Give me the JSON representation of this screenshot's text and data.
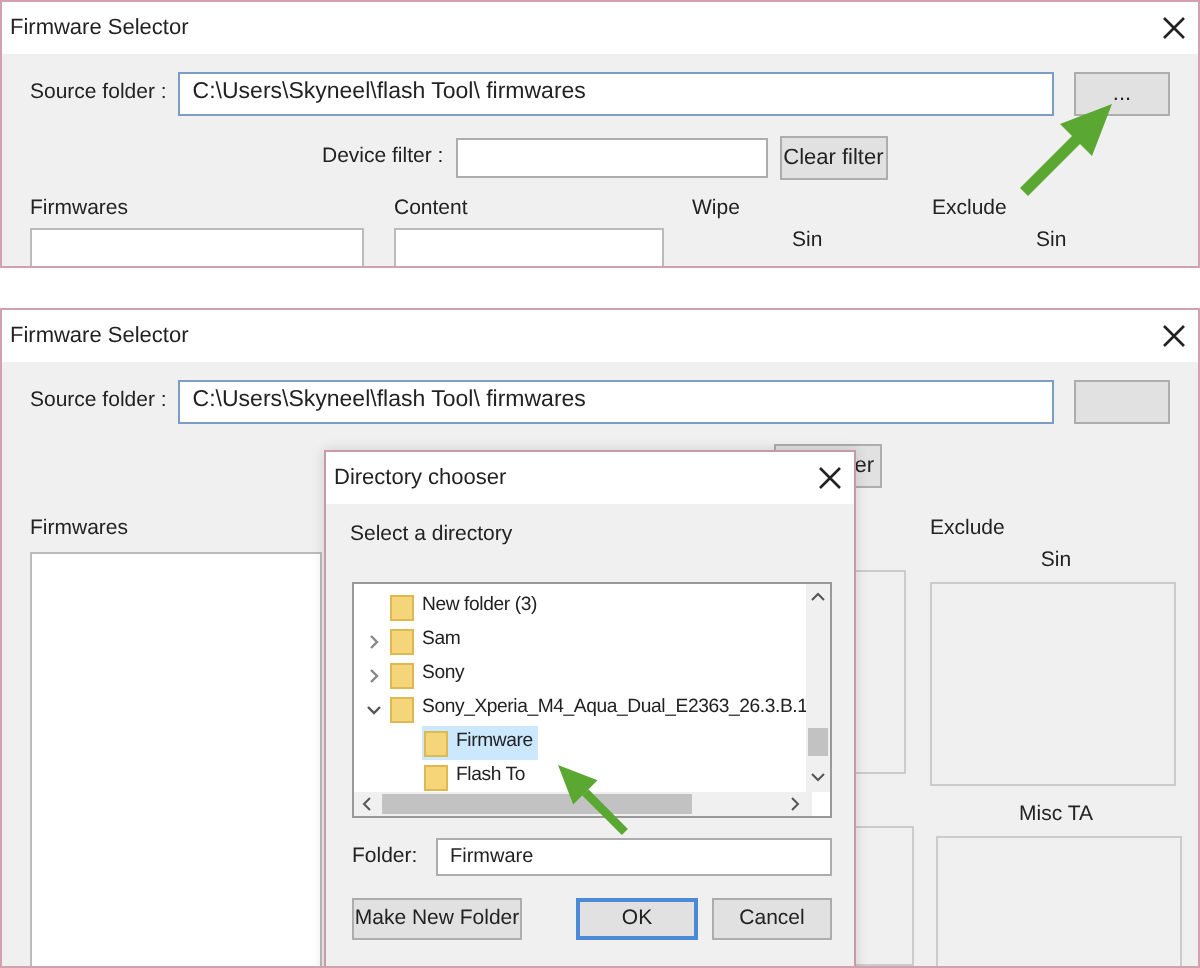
{
  "first_window": {
    "title": "Firmware Selector",
    "source_folder_label": "Source folder :",
    "source_folder_value": "C:\\Users\\Skyneel\\flash Tool\\ firmwares",
    "browse_button": "...",
    "device_filter_label": "Device filter :",
    "clear_filter_button": "Clear filter",
    "section_labels": [
      "Firmwares",
      "Content",
      "Wipe",
      "Exclude"
    ],
    "sin_labels": [
      "Sin",
      "Sin"
    ]
  },
  "second_window": {
    "title": "Firmware Selector",
    "source_folder_label": "Source folder :",
    "source_folder_value": "C:\\Users\\Skyneel\\flash Tool\\ firmwares",
    "clear_filter_button": "er",
    "firmwares_label": "Firmwares",
    "exclude_label": "Exclude",
    "sin_label": "Sin",
    "misc_ta_label": "Misc TA"
  },
  "directory_chooser": {
    "title": "Directory chooser",
    "prompt": "Select a directory",
    "tree": [
      {
        "kind": "leaf",
        "label": "New folder (3)",
        "selected": false
      },
      {
        "kind": "collapsed",
        "label": "Sam",
        "selected": false
      },
      {
        "kind": "collapsed",
        "label": "Sony",
        "selected": false
      },
      {
        "kind": "expanded",
        "label": "Sony_Xperia_M4_Aqua_Dual_E2363_26.3.B.1",
        "selected": false,
        "children": [
          {
            "kind": "leaf",
            "label": "Firmware",
            "selected": true
          },
          {
            "kind": "leaf",
            "label": "Flash To",
            "selected": false
          }
        ]
      }
    ],
    "folder_label": "Folder:",
    "folder_value": "Firmware",
    "buttons": [
      {
        "label": "Make New Folder",
        "default": false
      },
      {
        "label": "OK",
        "default": true
      },
      {
        "label": "Cancel",
        "default": false
      }
    ]
  }
}
